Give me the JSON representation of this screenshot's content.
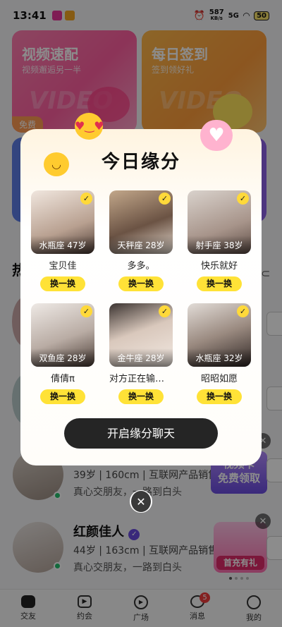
{
  "status_bar": {
    "time": "13:41",
    "net_speed": "587",
    "net_unit": "KB/s",
    "signal": "5G",
    "battery": "50"
  },
  "top_cards": [
    {
      "title": "视频速配",
      "subtitle": "视频邂逅另一半",
      "watermark": "VIDEO",
      "badge": "免费"
    },
    {
      "title": "每日签到",
      "subtitle": "签到领好礼",
      "watermark": "VIDEO"
    }
  ],
  "section": {
    "title": "热"
  },
  "list": [
    {
      "info": "39岁 | 160cm | 互联网产品销售",
      "bio": "真心交朋友，一路到白头"
    },
    {
      "name": "红颜佳人",
      "info": "44岁 | 163cm | 互联网产品销售",
      "bio": "真心交朋友，一路到白头"
    }
  ],
  "promos": [
    {
      "text": "视频卡免费领取",
      "line1": "视频卡",
      "line2": "免费领取"
    },
    {
      "text": "首充有礼"
    }
  ],
  "modal": {
    "title": "今日缘分",
    "swap_label": "换一换",
    "cta": "开启缘分聊天",
    "profiles": [
      {
        "tag": "水瓶座 47岁",
        "name": "宝贝佳"
      },
      {
        "tag": "天秤座 28岁",
        "name": "多多。"
      },
      {
        "tag": "射手座 38岁",
        "name": "快乐就好"
      },
      {
        "tag": "双鱼座 28岁",
        "name": "倩倩π"
      },
      {
        "tag": "金牛座 28岁",
        "name": "对方正在输入…"
      },
      {
        "tag": "水瓶座 32岁",
        "name": "昭昭如愿"
      }
    ]
  },
  "nav": {
    "items": [
      {
        "label": "交友",
        "icon": "home-icon"
      },
      {
        "label": "约会",
        "icon": "video-icon"
      },
      {
        "label": "广场",
        "icon": "plaza-icon"
      },
      {
        "label": "消息",
        "icon": "message-icon",
        "badge": "5"
      },
      {
        "label": "我的",
        "icon": "profile-icon"
      }
    ]
  }
}
